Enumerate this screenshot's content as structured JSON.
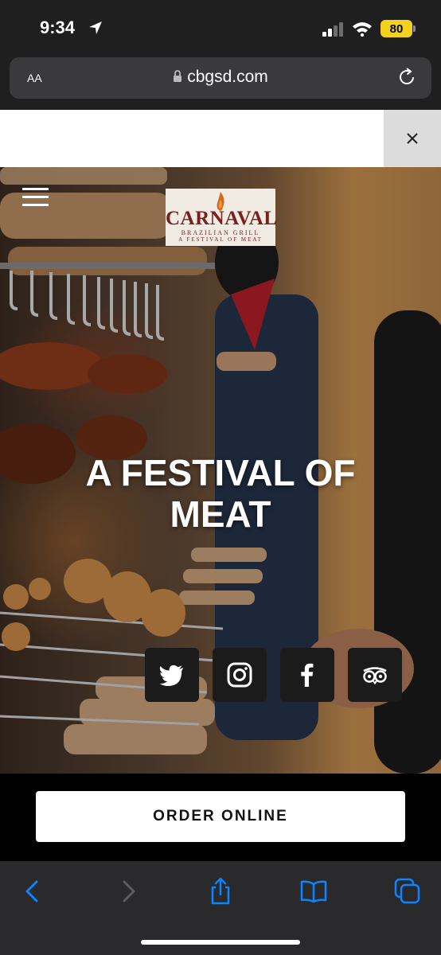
{
  "status_bar": {
    "time": "9:34",
    "battery": "80",
    "icons": [
      "location-arrow-icon",
      "signal-icon",
      "wifi-icon",
      "battery-icon"
    ]
  },
  "browser": {
    "text_size_label": "AA",
    "url": "cbgsd.com",
    "icons": [
      "lock-icon",
      "reload-icon"
    ]
  },
  "banner": {
    "close_icon": "close-icon"
  },
  "hero": {
    "logo": {
      "name": "CARNAVAL",
      "sub1": "BRAZILIAN GRILL",
      "sub2": "A FESTIVAL OF MEAT"
    },
    "headline_line1": "A FESTIVAL OF",
    "headline_line2": "MEAT",
    "social": [
      "twitter-icon",
      "instagram-icon",
      "facebook-icon",
      "tripadvisor-icon"
    ]
  },
  "order": {
    "button_label": "ORDER ONLINE"
  },
  "toolbar": {
    "icons": [
      "back-icon",
      "forward-icon",
      "share-icon",
      "bookmarks-icon",
      "tabs-icon"
    ],
    "accent": "#0a84ff"
  }
}
